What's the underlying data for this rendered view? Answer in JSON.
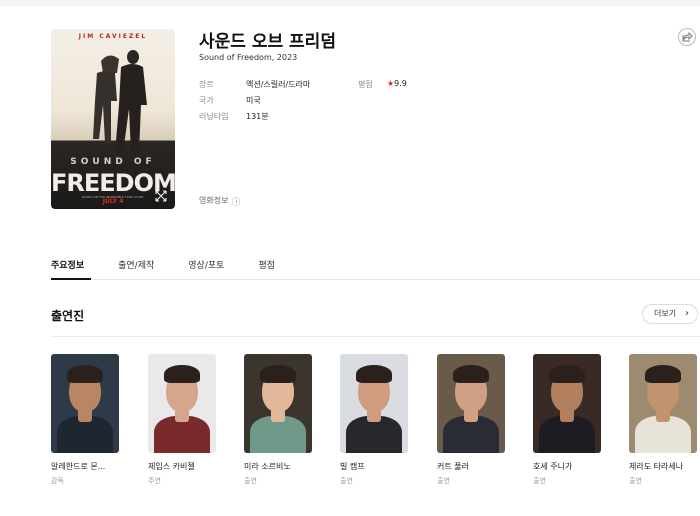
{
  "movie": {
    "title": "사운드 오브 프리덤",
    "subtitle": "Sound of Freedom, 2023",
    "genre_label": "장르",
    "genre": "액션/스릴러/드라마",
    "rating_label": "평점",
    "rating": "9.9",
    "country_label": "국가",
    "country": "미국",
    "runtime_label": "러닝타임",
    "runtime": "131분",
    "info_link": "영화정보",
    "info_badge": "i"
  },
  "poster": {
    "actor": "JIM CAVIEZEL",
    "line1": "SOUND OF",
    "line2": "FREEDOM",
    "tagline": "BASED ON THE INCREDIBLE TRUE STORY",
    "release": "JULY 4"
  },
  "tabs": [
    {
      "label": "주요정보"
    },
    {
      "label": "출연/제작"
    },
    {
      "label": "영상/포토"
    },
    {
      "label": "평점"
    }
  ],
  "cast_section": {
    "title": "출연진",
    "more": "더보기"
  },
  "cast": [
    {
      "name": "알레한드로 몬...",
      "role": "감독",
      "bg": "#2f3a48",
      "skin": "#b98664",
      "shirt": "#1e2630"
    },
    {
      "name": "제임스 카비젤",
      "role": "주연",
      "bg": "#e9e9e9",
      "skin": "#d5a58c",
      "shirt": "#7a2a2a"
    },
    {
      "name": "미라 소르비노",
      "role": "출연",
      "bg": "#3b352d",
      "skin": "#e3b89a",
      "shirt": "#6f9a8a"
    },
    {
      "name": "빌 캠프",
      "role": "출연",
      "bg": "#d9dde2",
      "skin": "#d09c80",
      "shirt": "#26282e"
    },
    {
      "name": "커트 풀러",
      "role": "출연",
      "bg": "#6a5a4a",
      "skin": "#cf9f86",
      "shirt": "#2a2c33"
    },
    {
      "name": "호세 주니가",
      "role": "출연",
      "bg": "#3a2a26",
      "skin": "#b3805f",
      "shirt": "#1c1c22"
    },
    {
      "name": "제라도 타라세나",
      "role": "출연",
      "bg": "#9c8b6e",
      "skin": "#c3926e",
      "shirt": "#e7e3d8"
    }
  ]
}
